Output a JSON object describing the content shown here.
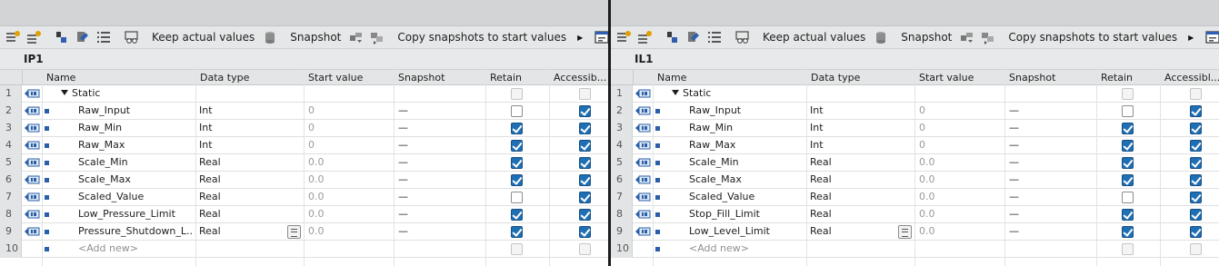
{
  "colors": {
    "accent": "#1f6fb5",
    "toolbar_bg": "#e6e7e8",
    "divider": "#1b1b1b"
  },
  "panes": [
    {
      "id": "left",
      "toolbar": {
        "keep_actual_values": "Keep actual values",
        "snapshot": "Snapshot",
        "copy_snapshots": "Copy snapshots to start values",
        "icons": [
          "insert-row-icon",
          "add-row-icon",
          "expand-icon",
          "collapse-icon",
          "list-view-icon",
          "monitor-glasses-icon",
          "database-icon",
          "snapshot-icon",
          "copy-snapshot-icon",
          "more-arrow-icon",
          "window-icon"
        ]
      },
      "block_name": "IP1",
      "columns": [
        "Name",
        "Data type",
        "Start value",
        "Snapshot",
        "Retain",
        "Accessib..."
      ],
      "rows": [
        {
          "n": "1",
          "name": "Static",
          "type": "",
          "start": "",
          "snap": "",
          "retain": "dim",
          "access": "dim",
          "kind": "static"
        },
        {
          "n": "2",
          "name": "Raw_Input",
          "type": "Int",
          "start": "0",
          "snap": "—",
          "retain": "off",
          "access": "on",
          "kind": "var"
        },
        {
          "n": "3",
          "name": "Raw_Min",
          "type": "Int",
          "start": "0",
          "snap": "—",
          "retain": "on",
          "access": "on",
          "kind": "var"
        },
        {
          "n": "4",
          "name": "Raw_Max",
          "type": "Int",
          "start": "0",
          "snap": "—",
          "retain": "on",
          "access": "on",
          "kind": "var"
        },
        {
          "n": "5",
          "name": "Scale_Min",
          "type": "Real",
          "start": "0.0",
          "snap": "—",
          "retain": "on",
          "access": "on",
          "kind": "var"
        },
        {
          "n": "6",
          "name": "Scale_Max",
          "type": "Real",
          "start": "0.0",
          "snap": "—",
          "retain": "on",
          "access": "on",
          "kind": "var"
        },
        {
          "n": "7",
          "name": "Scaled_Value",
          "type": "Real",
          "start": "0.0",
          "snap": "—",
          "retain": "off",
          "access": "on",
          "kind": "var"
        },
        {
          "n": "8",
          "name": "Low_Pressure_Limit",
          "type": "Real",
          "start": "0.0",
          "snap": "—",
          "retain": "on",
          "access": "on",
          "kind": "var"
        },
        {
          "n": "9",
          "name": "Pressure_Shutdown_L...",
          "type": "Real",
          "start": "0.0",
          "snap": "—",
          "retain": "on",
          "access": "on",
          "kind": "var",
          "dropdown": true
        },
        {
          "n": "10",
          "name": "<Add new>",
          "type": "",
          "start": "",
          "snap": "",
          "retain": "dim",
          "access": "dim",
          "kind": "add"
        }
      ]
    },
    {
      "id": "right",
      "toolbar": {
        "keep_actual_values": "Keep actual values",
        "snapshot": "Snapshot",
        "copy_snapshots": "Copy snapshots to start values",
        "icons": [
          "insert-row-icon",
          "add-row-icon",
          "expand-icon",
          "collapse-icon",
          "list-view-icon",
          "monitor-glasses-icon",
          "database-icon",
          "snapshot-icon",
          "copy-snapshot-icon",
          "more-arrow-icon",
          "window-icon"
        ]
      },
      "block_name": "IL1",
      "columns": [
        "Name",
        "Data type",
        "Start value",
        "Snapshot",
        "Retain",
        "Accessibl..."
      ],
      "rows": [
        {
          "n": "1",
          "name": "Static",
          "type": "",
          "start": "",
          "snap": "",
          "retain": "dim",
          "access": "dim",
          "kind": "static"
        },
        {
          "n": "2",
          "name": "Raw_Input",
          "type": "Int",
          "start": "0",
          "snap": "—",
          "retain": "off",
          "access": "on",
          "kind": "var"
        },
        {
          "n": "3",
          "name": "Raw_Min",
          "type": "Int",
          "start": "0",
          "snap": "—",
          "retain": "on",
          "access": "on",
          "kind": "var"
        },
        {
          "n": "4",
          "name": "Raw_Max",
          "type": "Int",
          "start": "0",
          "snap": "—",
          "retain": "on",
          "access": "on",
          "kind": "var"
        },
        {
          "n": "5",
          "name": "Scale_Min",
          "type": "Real",
          "start": "0.0",
          "snap": "—",
          "retain": "on",
          "access": "on",
          "kind": "var"
        },
        {
          "n": "6",
          "name": "Scale_Max",
          "type": "Real",
          "start": "0.0",
          "snap": "—",
          "retain": "on",
          "access": "on",
          "kind": "var"
        },
        {
          "n": "7",
          "name": "Scaled_Value",
          "type": "Real",
          "start": "0.0",
          "snap": "—",
          "retain": "off",
          "access": "on",
          "kind": "var"
        },
        {
          "n": "8",
          "name": "Stop_Fill_Limit",
          "type": "Real",
          "start": "0.0",
          "snap": "—",
          "retain": "on",
          "access": "on",
          "kind": "var"
        },
        {
          "n": "9",
          "name": "Low_Level_Limit",
          "type": "Real",
          "start": "0.0",
          "snap": "—",
          "retain": "on",
          "access": "on",
          "kind": "var",
          "dropdown": true
        },
        {
          "n": "10",
          "name": "<Add new>",
          "type": "",
          "start": "",
          "snap": "",
          "retain": "dim",
          "access": "dim",
          "kind": "add"
        }
      ]
    }
  ]
}
